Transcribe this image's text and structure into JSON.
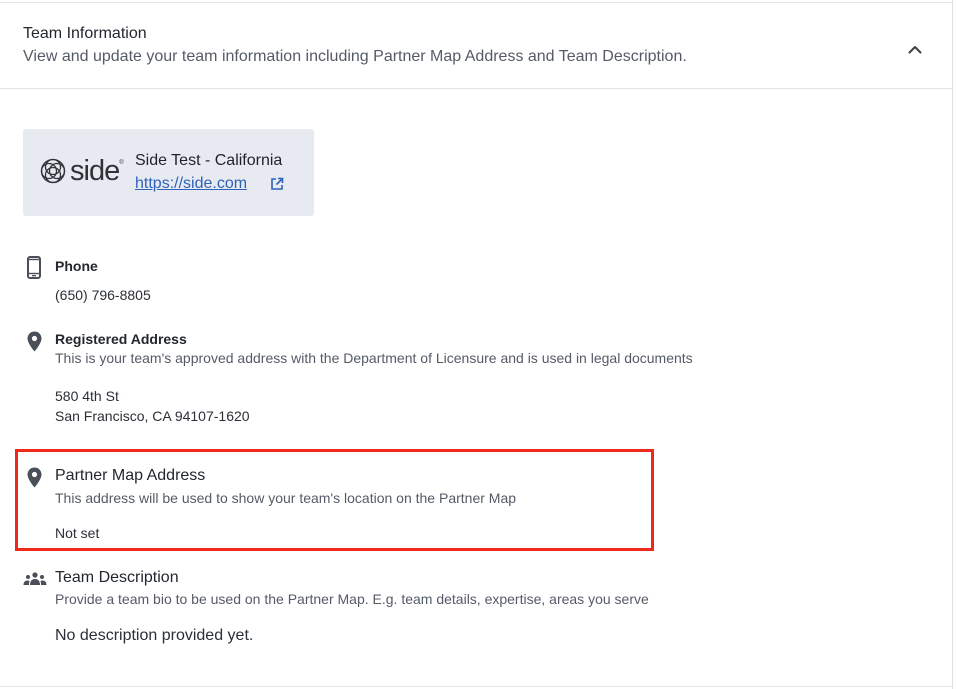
{
  "header": {
    "title": "Team Information",
    "subtitle": "View and update your team information including Partner Map Address and Team Description.",
    "collapse_icon": "chevron-up-icon"
  },
  "team_card": {
    "logo_text": "side",
    "logo_reg": "®",
    "name": "Side Test - California",
    "url": "https://side.com",
    "link_icon": "external-link-icon"
  },
  "phone": {
    "icon": "phone-icon",
    "label": "Phone",
    "value": "(650) 796-8805"
  },
  "registered_address": {
    "icon": "map-pin-icon",
    "label": "Registered Address",
    "description": "This is your team's approved address with the Department of Licensure and is used in legal documents",
    "line1": "580 4th St",
    "line2": "San Francisco, CA 94107-1620"
  },
  "partner_map_address": {
    "icon": "map-pin-icon",
    "label": "Partner Map Address",
    "description": "This address will be used to show your team's location on the Partner Map",
    "value": "Not set",
    "highlight_color": "#f0281b"
  },
  "team_description": {
    "icon": "people-group-icon",
    "label": "Team Description",
    "description": "Provide a team bio to be used on the Partner Map. E.g. team details, expertise, areas you serve",
    "value": "No description provided yet."
  },
  "colors": {
    "link": "#2f63b8",
    "card_bg": "#e8eaf2",
    "icon": "#4a4f58"
  }
}
